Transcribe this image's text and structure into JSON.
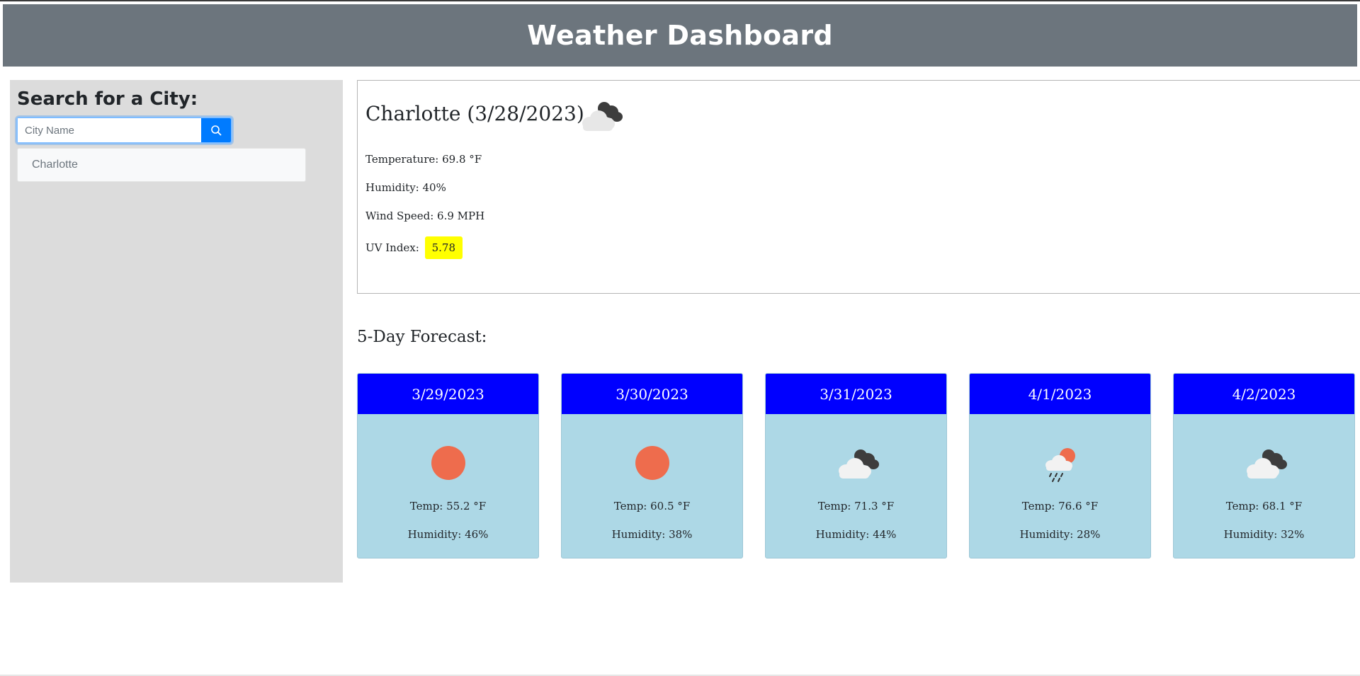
{
  "header": {
    "title": "Weather Dashboard"
  },
  "sidebar": {
    "title": "Search for a City:",
    "search": {
      "placeholder": "City Name",
      "value": ""
    },
    "history": [
      {
        "label": "Charlotte"
      }
    ]
  },
  "current": {
    "title": "Charlotte (3/28/2023)",
    "icon": "broken-clouds-icon",
    "temperature": "Temperature: 69.8 °F",
    "humidity": "Humidity: 40%",
    "wind": "Wind Speed: 6.9 MPH",
    "uv_label": "UV Index:",
    "uv_value": "5.78",
    "uv_color": "#ffff00"
  },
  "forecast": {
    "title": "5-Day Forecast:",
    "days": [
      {
        "date": "3/29/2023",
        "icon": "sun-icon",
        "temp": "Temp: 55.2 °F",
        "humidity": "Humidity: 46%"
      },
      {
        "date": "3/30/2023",
        "icon": "sun-icon",
        "temp": "Temp: 60.5 °F",
        "humidity": "Humidity: 38%"
      },
      {
        "date": "3/31/2023",
        "icon": "broken-clouds-icon",
        "temp": "Temp: 71.3 °F",
        "humidity": "Humidity: 44%"
      },
      {
        "date": "4/1/2023",
        "icon": "rain-sun-icon",
        "temp": "Temp: 76.6 °F",
        "humidity": "Humidity: 28%"
      },
      {
        "date": "4/2/2023",
        "icon": "broken-clouds-icon",
        "temp": "Temp: 68.1 °F",
        "humidity": "Humidity: 32%"
      }
    ]
  },
  "colors": {
    "header_bg": "#6c757d",
    "sidebar_bg": "#dcdcdc",
    "search_button": "#007bff",
    "card_header": "#0000ff",
    "card_body": "#add8e6",
    "sun": "#ee6c4d"
  }
}
